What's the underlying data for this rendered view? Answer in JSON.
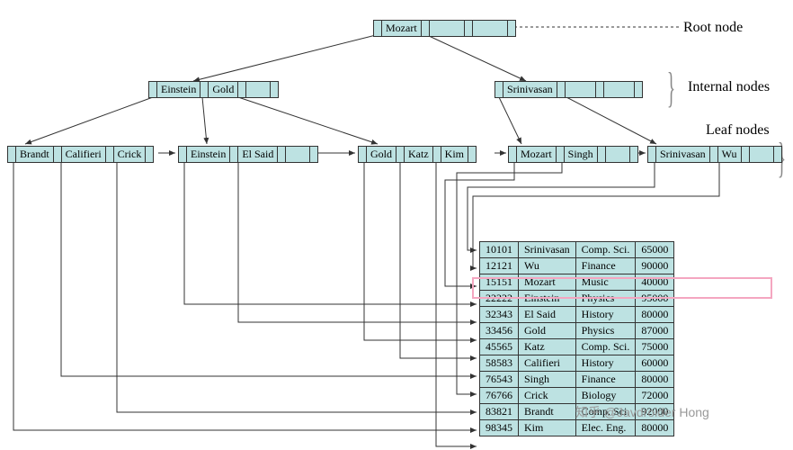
{
  "labels": {
    "root": "Root node",
    "internal": "Internal nodes",
    "leaf": "Leaf nodes"
  },
  "tree": {
    "root": {
      "keys": [
        "Mozart"
      ]
    },
    "internal": [
      {
        "keys": [
          "Einstein",
          "Gold"
        ]
      },
      {
        "keys": [
          "Srinivasan"
        ]
      }
    ],
    "leaves": [
      {
        "keys": [
          "Brandt",
          "Califieri",
          "Crick"
        ]
      },
      {
        "keys": [
          "Einstein",
          "El Said"
        ]
      },
      {
        "keys": [
          "Gold",
          "Katz",
          "Kim"
        ]
      },
      {
        "keys": [
          "Mozart",
          "Singh"
        ]
      },
      {
        "keys": [
          "Srinivasan",
          "Wu"
        ]
      }
    ]
  },
  "table": {
    "rows": [
      {
        "id": "10101",
        "name": "Srinivasan",
        "dept": "Comp. Sci.",
        "salary": "65000"
      },
      {
        "id": "12121",
        "name": "Wu",
        "dept": "Finance",
        "salary": "90000"
      },
      {
        "id": "15151",
        "name": "Mozart",
        "dept": "Music",
        "salary": "40000"
      },
      {
        "id": "22222",
        "name": "Einstein",
        "dept": "Physics",
        "salary": "95000"
      },
      {
        "id": "32343",
        "name": "El Said",
        "dept": "History",
        "salary": "80000"
      },
      {
        "id": "33456",
        "name": "Gold",
        "dept": "Physics",
        "salary": "87000"
      },
      {
        "id": "45565",
        "name": "Katz",
        "dept": "Comp. Sci.",
        "salary": "75000"
      },
      {
        "id": "58583",
        "name": "Califieri",
        "dept": "History",
        "salary": "60000"
      },
      {
        "id": "76543",
        "name": "Singh",
        "dept": "Finance",
        "salary": "80000"
      },
      {
        "id": "76766",
        "name": "Crick",
        "dept": "Biology",
        "salary": "72000"
      },
      {
        "id": "83821",
        "name": "Brandt",
        "dept": "Comp. Sci.",
        "salary": "92000"
      },
      {
        "id": "98345",
        "name": "Kim",
        "dept": "Elec. Eng.",
        "salary": "80000"
      }
    ],
    "highlight_index": 2
  },
  "watermark": "知乎 @Javdroider Hong"
}
